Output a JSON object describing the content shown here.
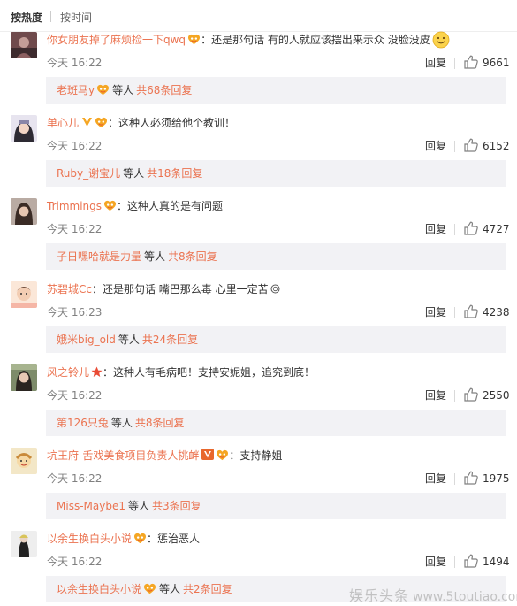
{
  "sort": {
    "hot": "按热度",
    "time": "按时间"
  },
  "comments": [
    {
      "user": "你女朋友掉了麻烦捡一下qwq",
      "text": "：还是那句话 有的人就应该摆出来示众 没脸没皮",
      "time": "今天 16:22",
      "reply_label": "回复",
      "likes": "9661",
      "reply": {
        "user": "老斑马y",
        "mid": "等人",
        "total": "共68条回复"
      }
    },
    {
      "user": "单心儿",
      "text": "：这种人必须给他个教训！",
      "time": "今天 16:22",
      "reply_label": "回复",
      "likes": "6152",
      "reply": {
        "user": "Ruby_谢宝儿",
        "mid": "等人",
        "total": "共18条回复"
      }
    },
    {
      "user": "Trimmings",
      "text": "：这种人真的是有问题",
      "time": "今天 16:22",
      "reply_label": "回复",
      "likes": "4727",
      "reply": {
        "user": "子日嘿哈就是力量",
        "mid": "等人",
        "total": "共8条回复"
      }
    },
    {
      "user": "苏碧城Cc",
      "text": "：还是那句话  嘴巴那么毒   心里一定苦",
      "time": "今天 16:23",
      "reply_label": "回复",
      "likes": "4238",
      "reply": {
        "user": "娥米big_old",
        "mid": "等人",
        "total": "共24条回复"
      }
    },
    {
      "user": "风之铃儿",
      "text": "：这种人有毛病吧！支持安妮姐，追究到底！",
      "time": "今天 16:22",
      "reply_label": "回复",
      "likes": "2550",
      "reply": {
        "user": "第126只兔",
        "mid": "等人",
        "total": "共8条回复"
      }
    },
    {
      "user": "坑王府-舌戏美食项目负责人挑衅",
      "text": "：支持静姐",
      "time": "今天 16:22",
      "reply_label": "回复",
      "likes": "1975",
      "reply": {
        "user": "Miss-Maybe1",
        "mid": "等人",
        "total": "共3条回复"
      }
    },
    {
      "user": "以余生换白头小说",
      "text": "：惩治恶人",
      "time": "今天 16:22",
      "reply_label": "回复",
      "likes": "1494",
      "reply": {
        "user": "以余生换白头小说",
        "mid": "等人",
        "total": "共2条回复"
      }
    }
  ],
  "watermark": {
    "brand": "娱乐头条",
    "url": "www.5toutiao.com"
  },
  "colors": {
    "username": "#eb7350",
    "text": "#333333",
    "muted": "#808080",
    "reply_bg": "#f2f2f5"
  }
}
